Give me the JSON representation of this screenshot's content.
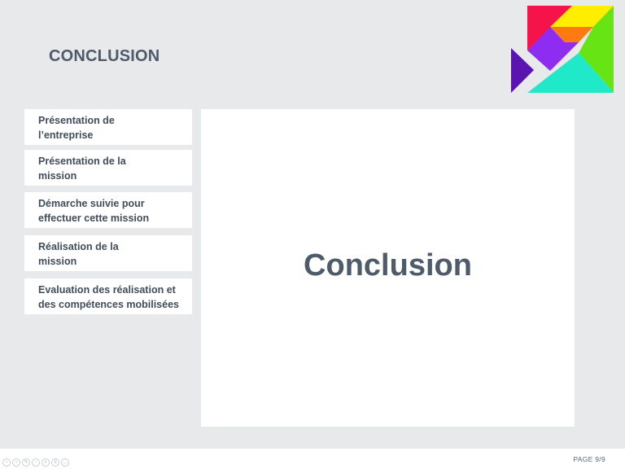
{
  "slide": {
    "title": "CONCLUSION",
    "content_heading": "Conclusion"
  },
  "nav": {
    "items": [
      {
        "label": "Présentation de\nl’entreprise"
      },
      {
        "label": "Présentation de la\nmission"
      },
      {
        "label": "Démarche suivie pour\neffectuer cette mission"
      },
      {
        "label": "Réalisation de la\nmission"
      },
      {
        "label": "Evaluation des réalisation et\ndes compétences mobilisées"
      }
    ]
  },
  "footer": {
    "page_label": "PAGE 9/9"
  },
  "player_controls": [
    {
      "icon": "previous-icon",
      "glyph": "‹"
    },
    {
      "icon": "next-icon",
      "glyph": "›"
    },
    {
      "icon": "pen-icon",
      "glyph": "✎"
    },
    {
      "icon": "slides-icon",
      "glyph": "▫"
    },
    {
      "icon": "zoom-icon",
      "glyph": "⌕"
    },
    {
      "icon": "menu-icon",
      "glyph": "≡"
    },
    {
      "icon": "more-icon",
      "glyph": "…"
    }
  ],
  "colors": {
    "background": "#e7e9eb",
    "title": "#4d5b6b",
    "nav_text": "#414d5a",
    "page_number": "#4d6b8a",
    "tangram_red": "#f5134a",
    "tangram_yellow": "#ffee00",
    "tangram_orange": "#ff7a12",
    "tangram_green": "#66e414",
    "tangram_purple": "#8f2cf2",
    "tangram_cyan": "#1fe9c9",
    "tangram_indigo": "#5a14b0"
  }
}
